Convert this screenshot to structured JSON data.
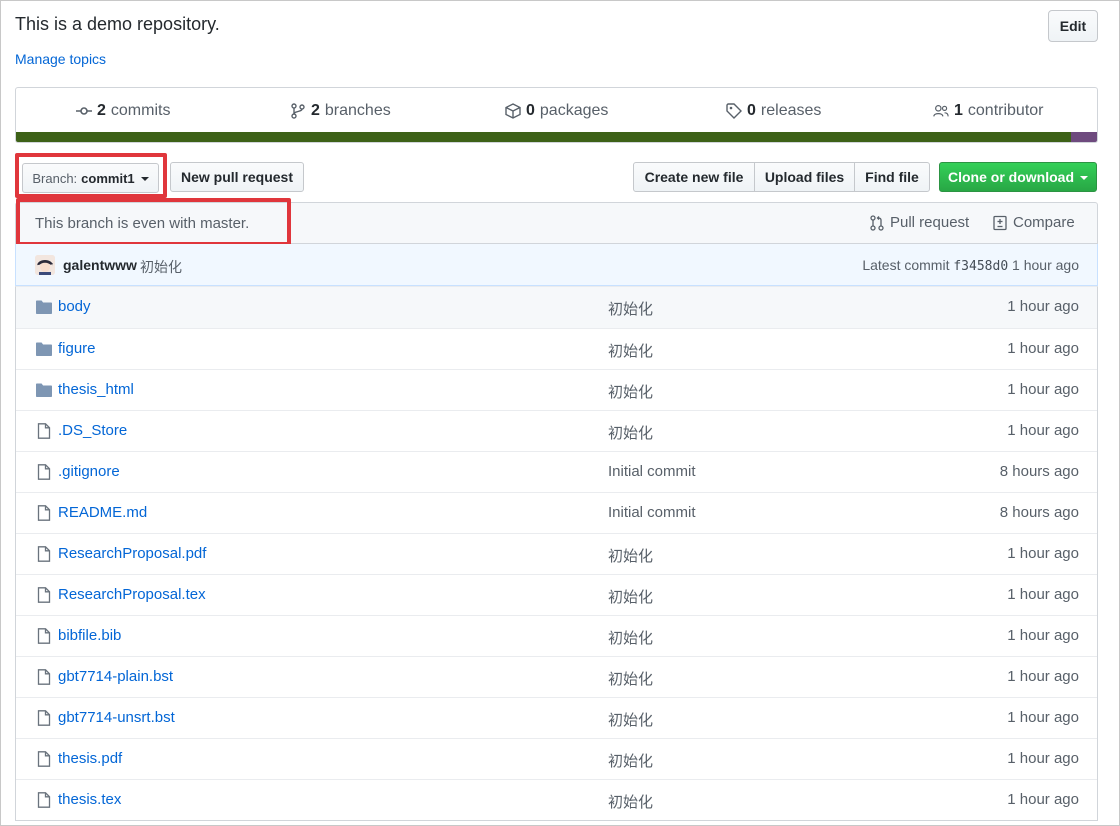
{
  "repo": {
    "description": "This is a demo repository.",
    "manage_topics": "Manage topics",
    "edit_label": "Edit"
  },
  "summary": {
    "commits": {
      "count": "2",
      "label": "commits"
    },
    "branches": {
      "count": "2",
      "label": "branches"
    },
    "packages": {
      "count": "0",
      "label": "packages"
    },
    "releases": {
      "count": "0",
      "label": "releases"
    },
    "contributors": {
      "count": "1",
      "label": "contributor"
    },
    "lang_colors": {
      "primary": "#3d6117",
      "secondary": "#6e4a7e"
    }
  },
  "toolbar": {
    "branch_label": "Branch:",
    "branch_value": "commit1",
    "new_pr": "New pull request",
    "create_file": "Create new file",
    "upload_files": "Upload files",
    "find_file": "Find file",
    "clone": "Clone or download"
  },
  "branch_info": {
    "message": "This branch is even with master.",
    "pull_request": "Pull request",
    "compare": "Compare"
  },
  "latest_commit": {
    "author": "galentwww",
    "message": "初始化",
    "label": "Latest commit",
    "sha": "f3458d0",
    "age": "1 hour ago"
  },
  "files": [
    {
      "name": "body",
      "type": "dir",
      "message": "初始化",
      "age": "1 hour ago"
    },
    {
      "name": "figure",
      "type": "dir",
      "message": "初始化",
      "age": "1 hour ago"
    },
    {
      "name": "thesis_html",
      "type": "dir",
      "message": "初始化",
      "age": "1 hour ago"
    },
    {
      "name": ".DS_Store",
      "type": "file",
      "message": "初始化",
      "age": "1 hour ago"
    },
    {
      "name": ".gitignore",
      "type": "file",
      "message": "Initial commit",
      "age": "8 hours ago"
    },
    {
      "name": "README.md",
      "type": "file",
      "message": "Initial commit",
      "age": "8 hours ago"
    },
    {
      "name": "ResearchProposal.pdf",
      "type": "file",
      "message": "初始化",
      "age": "1 hour ago"
    },
    {
      "name": "ResearchProposal.tex",
      "type": "file",
      "message": "初始化",
      "age": "1 hour ago"
    },
    {
      "name": "bibfile.bib",
      "type": "file",
      "message": "初始化",
      "age": "1 hour ago"
    },
    {
      "name": "gbt7714-plain.bst",
      "type": "file",
      "message": "初始化",
      "age": "1 hour ago"
    },
    {
      "name": "gbt7714-unsrt.bst",
      "type": "file",
      "message": "初始化",
      "age": "1 hour ago"
    },
    {
      "name": "thesis.pdf",
      "type": "file",
      "message": "初始化",
      "age": "1 hour ago"
    },
    {
      "name": "thesis.tex",
      "type": "file",
      "message": "初始化",
      "age": "1 hour ago"
    }
  ],
  "colors": {
    "link": "#0366d6",
    "highlight": "#e0363c",
    "clone_green": "#28a745"
  }
}
